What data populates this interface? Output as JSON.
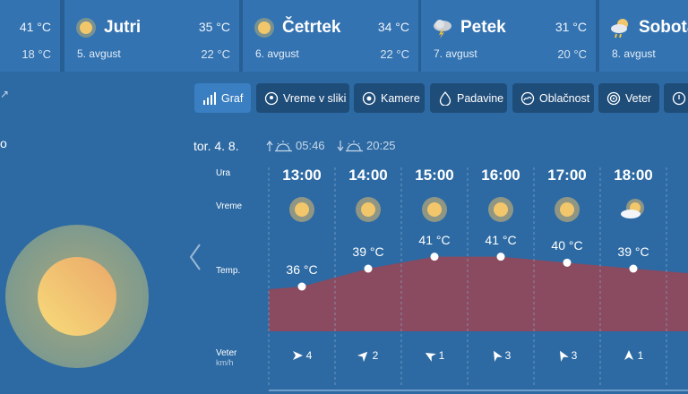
{
  "forecast_cards": [
    {
      "name": "",
      "date": "",
      "high": "41 °C",
      "low": "18 °C",
      "icon": "sun-icon"
    },
    {
      "name": "Jutri",
      "date": "5. avgust",
      "high": "35 °C",
      "low": "22 °C",
      "icon": "sun-icon"
    },
    {
      "name": "Četrtek",
      "date": "6. avgust",
      "high": "34 °C",
      "low": "22 °C",
      "icon": "sun-icon"
    },
    {
      "name": "Petek",
      "date": "7. avgust",
      "high": "31 °C",
      "low": "20 °C",
      "icon": "thunderstorm-icon"
    },
    {
      "name": "Sobota",
      "date": "8. avgust",
      "high": "",
      "low": "",
      "icon": "sun-cloud-rain-icon"
    }
  ],
  "tabs": [
    {
      "label": "Graf",
      "icon": "bar-chart-icon"
    },
    {
      "label": "Vreme v sliki",
      "icon": "location-pin-icon"
    },
    {
      "label": "Kamere",
      "icon": "camera-icon"
    },
    {
      "label": "Padavine",
      "icon": "raindrop-icon"
    },
    {
      "label": "Oblačnost",
      "icon": "cloud-icon"
    },
    {
      "label": "Veter",
      "icon": "wind-icon"
    },
    {
      "label": "",
      "icon": "thermometer-icon"
    }
  ],
  "day": {
    "label": "tor. 4. 8.",
    "sunrise": "05:46",
    "sunset": "20:25"
  },
  "rows": {
    "hour": "Ura",
    "weather": "Vreme",
    "temp": "Temp.",
    "wind": "Veter",
    "wind_unit": "km/h"
  },
  "hours": [
    {
      "time": "13:00",
      "temp": "36 °C",
      "temp_value": 36,
      "wind_speed": "4",
      "wind_dir_deg": 90,
      "icon": "sun-icon"
    },
    {
      "time": "14:00",
      "temp": "39 °C",
      "temp_value": 39,
      "wind_speed": "2",
      "wind_dir_deg": 45,
      "icon": "sun-icon"
    },
    {
      "time": "15:00",
      "temp": "41 °C",
      "temp_value": 41,
      "wind_speed": "1",
      "wind_dir_deg": -60,
      "icon": "sun-icon"
    },
    {
      "time": "16:00",
      "temp": "41 °C",
      "temp_value": 41,
      "wind_speed": "3",
      "wind_dir_deg": -30,
      "icon": "sun-icon"
    },
    {
      "time": "17:00",
      "temp": "40 °C",
      "temp_value": 40,
      "wind_speed": "3",
      "wind_dir_deg": -30,
      "icon": "sun-icon"
    },
    {
      "time": "18:00",
      "temp": "39 °C",
      "temp_value": 39,
      "wind_speed": "1",
      "wind_dir_deg": 0,
      "icon": "sun-cloud-icon"
    }
  ],
  "colors": {
    "background": "#2d6aa3",
    "card": "#3373b1",
    "tab": "#1f4d7a",
    "tab_active": "#3a7fc2",
    "temp_fill": "#8a4a60",
    "sun_core": "#f2c66a"
  }
}
